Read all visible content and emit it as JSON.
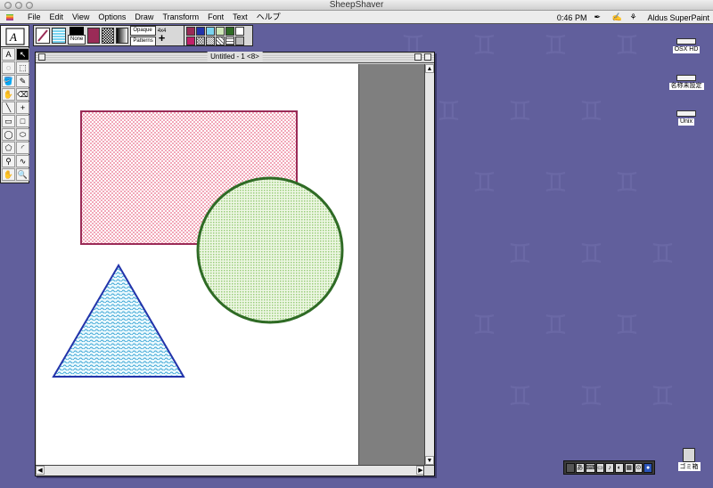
{
  "host": {
    "title": "SheepShaver"
  },
  "menubar": {
    "items": [
      "File",
      "Edit",
      "View",
      "Options",
      "Draw",
      "Transform",
      "Font",
      "Text",
      "ヘルプ"
    ],
    "time": "0:46 PM",
    "app_name": "Aldus SuperPaint"
  },
  "tool_palette": {
    "tools": [
      {
        "name": "text-tool",
        "glyph": "A"
      },
      {
        "name": "pointer-tool",
        "glyph": "↖"
      },
      {
        "name": "lasso-tool",
        "glyph": "◌"
      },
      {
        "name": "marquee-tool",
        "glyph": "⬚"
      },
      {
        "name": "bucket-tool",
        "glyph": "🪣"
      },
      {
        "name": "pencil-tool",
        "glyph": "✎"
      },
      {
        "name": "brush-tool",
        "glyph": "✋"
      },
      {
        "name": "eraser-tool",
        "glyph": "⌫"
      },
      {
        "name": "line-tool",
        "glyph": "╲"
      },
      {
        "name": "plus-tool",
        "glyph": "+"
      },
      {
        "name": "round-rect-tool",
        "glyph": "▭"
      },
      {
        "name": "rect-tool",
        "glyph": "□"
      },
      {
        "name": "oval-tool",
        "glyph": "◯"
      },
      {
        "name": "circle-tool",
        "glyph": "⬭"
      },
      {
        "name": "polygon-tool",
        "glyph": "⬠"
      },
      {
        "name": "arc-tool",
        "glyph": "◜"
      },
      {
        "name": "eyedropper-tool",
        "glyph": "⚲"
      },
      {
        "name": "freeform-tool",
        "glyph": "∿"
      },
      {
        "name": "hand-tool",
        "glyph": "✋"
      },
      {
        "name": "zoom-tool",
        "glyph": "🔍"
      }
    ]
  },
  "attributes": {
    "none_label": "None",
    "opaque_label": "Opaque",
    "patterns_label": "Patterns",
    "line_label": "4x4"
  },
  "document": {
    "title": "Untitled - 1 <8>"
  },
  "desktop_icons": [
    "OSX HD",
    "名称未設定",
    "Unix"
  ],
  "trash_label": "ゴミ箱",
  "colors": {
    "rect_stroke": "#9a2b57",
    "rect_fill": "#f7c9d3",
    "circle_stroke": "#2f6b25",
    "circle_fill": "#cfe8b9",
    "triangle_stroke": "#2233aa",
    "triangle_fill": "#7ad4f0"
  }
}
